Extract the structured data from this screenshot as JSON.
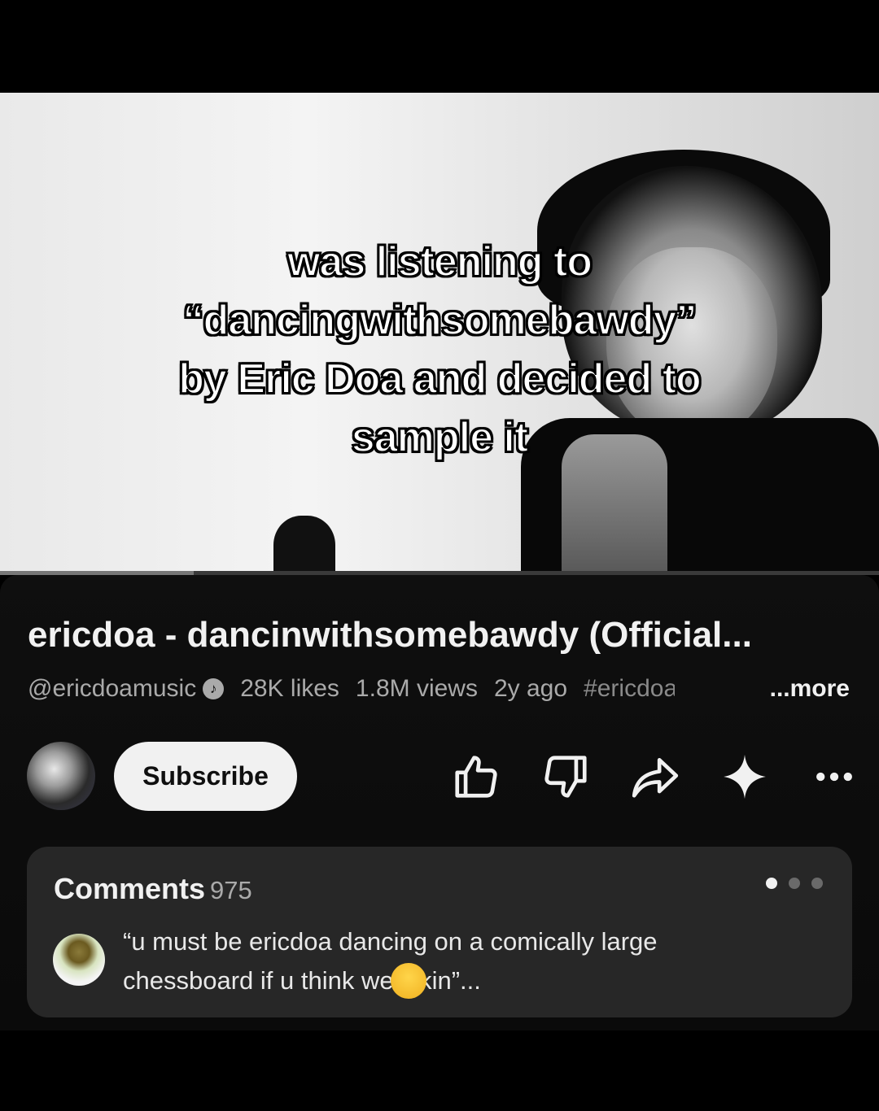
{
  "overlay": {
    "caption_lines": [
      "was listening to",
      "“dancingwithsomebawdy”",
      "by Eric Doa and decided to",
      "sample it"
    ]
  },
  "player": {
    "progress": 0.22
  },
  "video": {
    "title": "ericdoa - dancinwithsomebawdy (Official...",
    "channel": "@ericdoamusic",
    "likes": "28K likes",
    "views": "1.8M views",
    "age": "2y ago",
    "hashtag": "#ericdoa",
    "more_label": "...more"
  },
  "actions": {
    "subscribe_label": "Subscribe",
    "icons": [
      "like-icon",
      "dislike-icon",
      "share-icon",
      "sparkle-icon",
      "more-icon"
    ]
  },
  "comments": {
    "heading": "Comments",
    "count": "975",
    "pager_dots": 3,
    "active_dot": 0,
    "top_comment_start": "“u must be ericdoa dancing on a comically large chessboard if u think we",
    "top_comment_end": "ckin”...",
    "top_comment_emoji": "pleading-face-emoji"
  },
  "colors": {
    "background": "#000000",
    "panel": "#0f0f0f",
    "card": "#272727",
    "subscribe_bg": "#f1f1f1",
    "secondary_text": "#aaaaaa"
  }
}
